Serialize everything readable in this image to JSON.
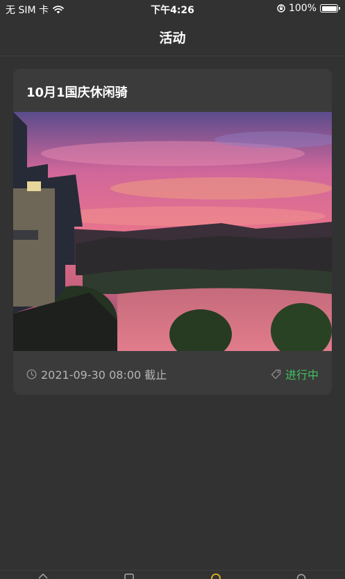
{
  "status_bar": {
    "carrier": "无 SIM 卡",
    "time": "下午4:26",
    "battery": "100%"
  },
  "nav": {
    "title": "活动"
  },
  "activity": {
    "title": "10月1国庆休闲骑",
    "deadline": "2021-09-30 08:00 截止",
    "status": "进行中",
    "status_color": "#3fc35f"
  },
  "icons": {
    "wifi": "wifi-icon",
    "orientation_lock": "orientation-lock-icon",
    "clock": "clock-icon",
    "tag": "tag-icon"
  }
}
